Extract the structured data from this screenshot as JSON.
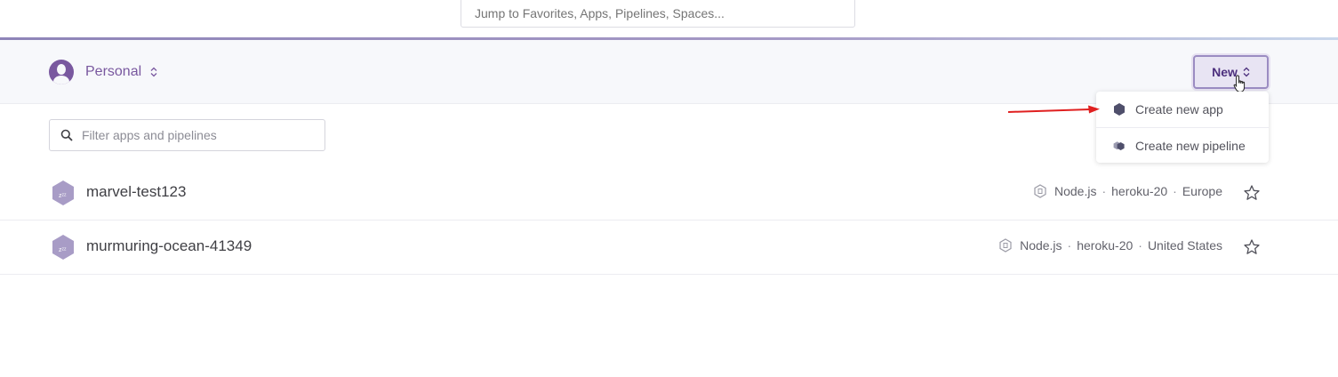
{
  "topbar": {
    "jump_placeholder": "Jump to Favorites, Apps, Pipelines, Spaces..."
  },
  "context": {
    "label": "Personal",
    "updown_up": "⌃",
    "updown_down": "⌄"
  },
  "new_menu": {
    "button_label": "New",
    "items": [
      {
        "label": "Create new app",
        "icon": "app-hexagon-icon"
      },
      {
        "label": "Create new pipeline",
        "icon": "pipeline-icon"
      }
    ]
  },
  "filter": {
    "placeholder": "Filter apps and pipelines"
  },
  "apps": [
    {
      "name": "marvel-test123",
      "language": "Node.js",
      "stack": "heroku-20",
      "region": "Europe"
    },
    {
      "name": "murmuring-ocean-41349",
      "language": "Node.js",
      "stack": "heroku-20",
      "region": "United States"
    }
  ],
  "meta_separator": "·",
  "colors": {
    "brand": "#79589f",
    "arrow": "#e02020",
    "accent_line": "#8e84b8"
  }
}
